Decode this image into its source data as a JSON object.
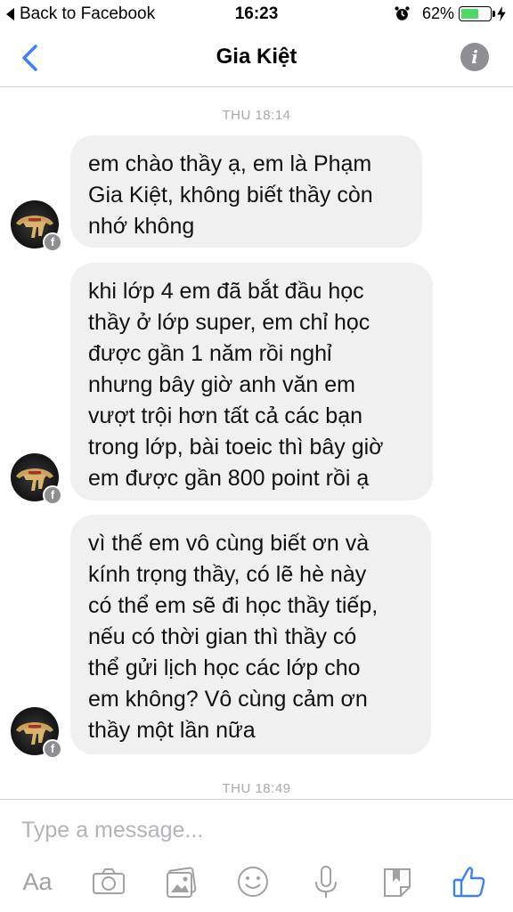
{
  "status_bar": {
    "back_label": "Back to Facebook",
    "time": "16:23",
    "battery_percent": "62%",
    "battery_level": 0.62
  },
  "nav": {
    "title": "Gia Kiệt",
    "info_glyph": "i"
  },
  "chat": {
    "timestamps": [
      "THU 18:14",
      "THU 18:49"
    ],
    "messages": [
      {
        "lines": [
          "em chào thầy ạ, em là Phạm",
          "Gia Kiệt, không biết thầy còn",
          "nhớ không"
        ]
      },
      {
        "lines": [
          "khi lớp 4 em đã bắt đầu học",
          "thầy ở lớp super, em chỉ học",
          "được gần 1 năm rồi nghỉ",
          "nhưng bây giờ anh văn em",
          "vượt trội hơn tất cả các bạn",
          "trong lớp, bài toeic thì bây giờ",
          "em được gần 800 point rồi ạ"
        ]
      },
      {
        "lines": [
          "vì thế em vô cùng biết ơn và",
          "kính trọng thầy, có lẽ hè này",
          "có thể em sẽ đi học thầy tiếp,",
          "nếu có thời gian thì thầy có",
          "thể gửi lịch học các lớp cho",
          "em không? Vô cùng cảm ơn",
          "thầy một lần nữa"
        ]
      }
    ],
    "avatar_badge": "f"
  },
  "composer": {
    "placeholder": "Type a message...",
    "aa_label": "Aa",
    "icons": [
      "text-format-icon",
      "camera-icon",
      "gallery-icon",
      "emoji-icon",
      "microphone-icon",
      "sticker-icon",
      "thumbs-up-icon"
    ]
  },
  "colors": {
    "accent": "#3b82f6",
    "bubble": "#f1f0f0",
    "muted": "#a8a8ad",
    "battery": "#4cd964"
  }
}
